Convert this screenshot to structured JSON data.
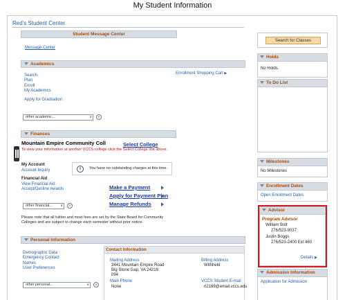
{
  "page_title": "My Student Information",
  "student_center": "Red's Student Center",
  "message_center": {
    "header": "Student Message Center",
    "link": "Message Center"
  },
  "academics": {
    "header": "Academics",
    "links": [
      "Search",
      "Plan",
      "Enroll",
      "My Academics"
    ],
    "graduation_link": "Apply for Graduation",
    "cart_link": "Enrollment Shopping Cart",
    "select": "other academic..."
  },
  "finances": {
    "header": "Finances",
    "school": "Mountain Empire Community Coll",
    "select_college": "Select College",
    "notice": "To view your information at another VCCS college click the Select College link above.",
    "my_account_label": "My Account",
    "account_inquiry": "Account Inquiry",
    "financial_aid_label": "Financial Aid",
    "view_financial_aid": "View Financial Aid",
    "accept_decline": "Accept/Decline Awards",
    "no_charges": "You have no outstanding charges at this time.",
    "make_payment": "Make a Payment",
    "apply_payment_plan": "Apply for Payment Plan",
    "manage_refunds": "Manage Refunds",
    "select": "other financial...",
    "tuition_note": "Please note that all tuition and most fees are set by the State Board for Community Colleges and are subject to change each semester without prior notice."
  },
  "personal": {
    "header": "Personal Information",
    "links": [
      "Demographic Data",
      "Emergency Contact",
      "Names",
      "User Preferences"
    ],
    "contact_header": "Contact Information",
    "mailing_label": "Mailing Address",
    "mailing_lines": [
      "3441 Mountain Empire Road",
      "Big Stone Gap, VA 24219",
      "094"
    ],
    "billing_label": "Billing Address",
    "billing_lines": [
      "Withheld"
    ],
    "main_phone_label": "Main Phone",
    "main_phone_value": "None",
    "email_label": "VCCS Student E-mail",
    "email_value": "rl2169@email.vccs.edu",
    "select": "other personal..."
  },
  "right": {
    "search_classes": "Search for Classes",
    "holds_header": "Holds",
    "holds_text": "No Holds.",
    "todo_header": "To Do List",
    "milestones_header": "Milestones",
    "milestones_text": "No Milestones",
    "enrollment_header": "Enrollment Dates",
    "enrollment_link": "Open Enrollment Dates",
    "advisor_header": "Advisor",
    "program_advisor": "Program Advisor",
    "advisor1_name": "William Bott",
    "advisor1_phone": "276/523-9037",
    "advisor2_name": "Justin Boggs",
    "advisor2_phone": "276/523-2400 Ext 460",
    "details": "Details",
    "admission_header": "Admission Information",
    "admission_link": "Application for Admission"
  }
}
